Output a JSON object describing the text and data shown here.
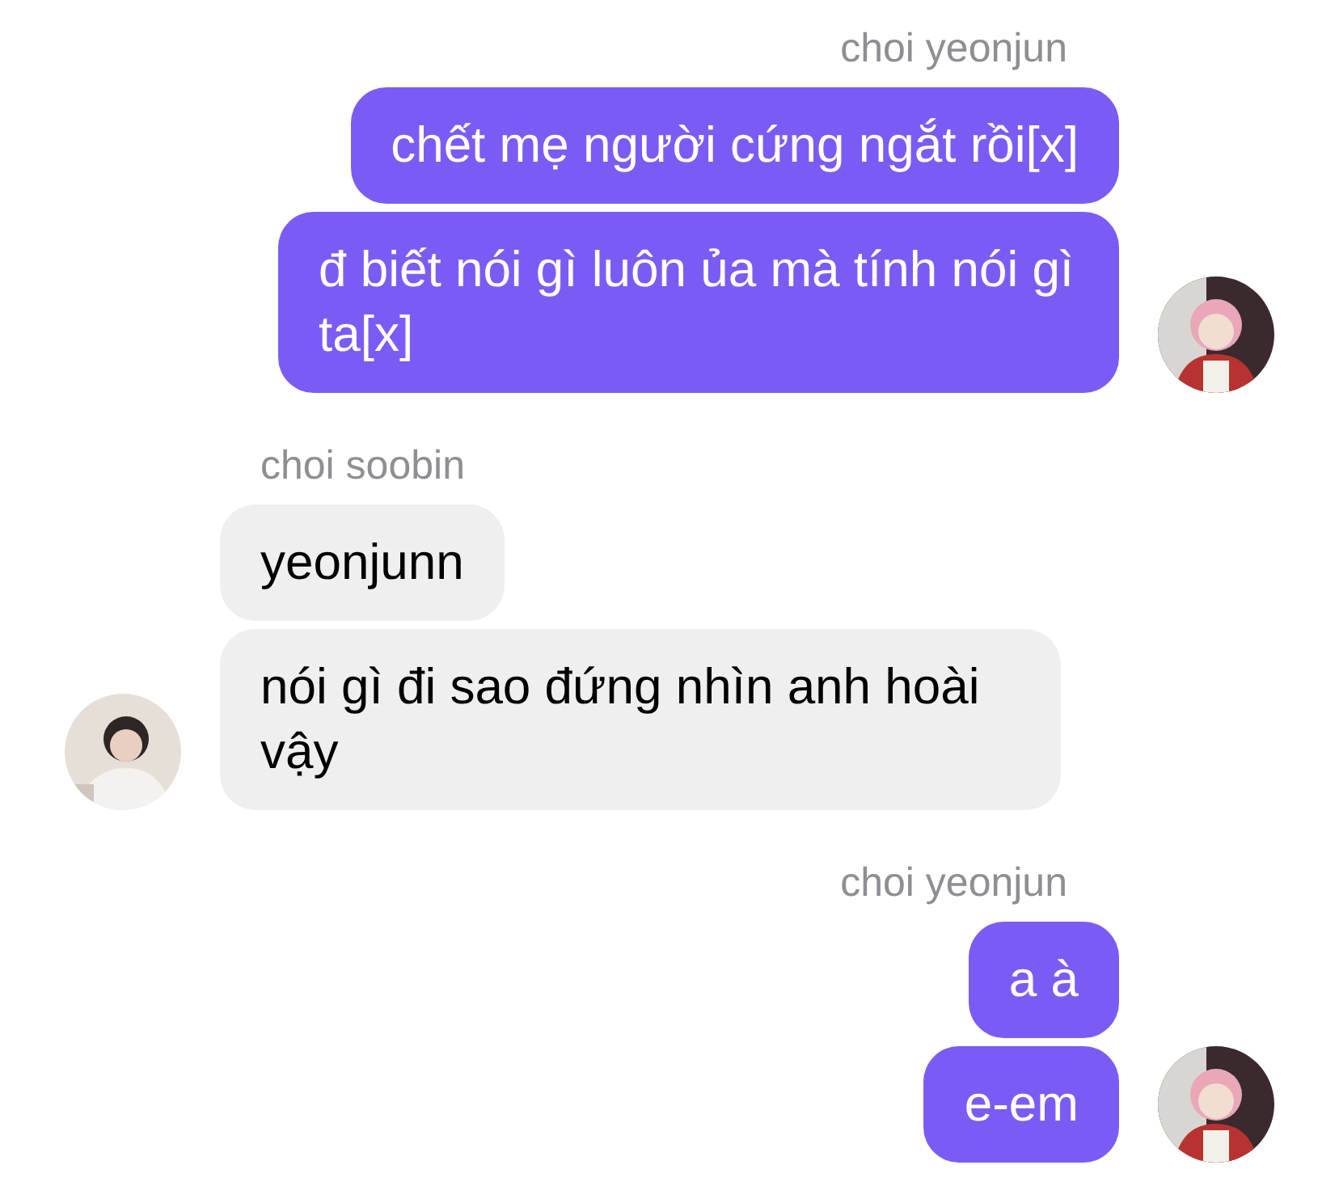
{
  "groups": [
    {
      "kind": "outgoing",
      "sender": "choi yeonjun",
      "messages": [
        "chết mẹ người cứng ngắt rồi[x]",
        "đ biết nói gì luôn ủa mà tính nói gì ta[x]"
      ]
    },
    {
      "kind": "incoming",
      "sender": "choi soobin",
      "messages": [
        "yeonjunn",
        "nói gì đi sao đứng nhìn anh hoài vậy"
      ]
    },
    {
      "kind": "outgoing",
      "sender": "choi yeonjun",
      "messages": [
        "a à",
        "e-em"
      ]
    }
  ]
}
